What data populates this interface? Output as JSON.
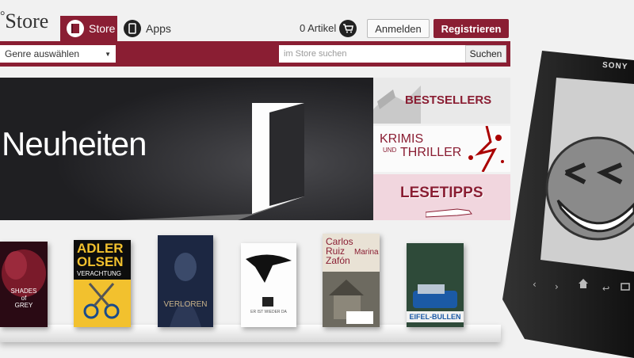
{
  "header": {
    "logo_text": "Store",
    "tabs": [
      {
        "label": "Store",
        "icon": "book-icon",
        "active": true
      },
      {
        "label": "Apps",
        "icon": "tablet-icon",
        "active": false
      }
    ],
    "cart_label": "0 Artikel",
    "login_label": "Anmelden",
    "register_label": "Registrieren"
  },
  "nav": {
    "genre_select": "Genre auswählen",
    "search_placeholder": "im Store suchen",
    "search_button": "Suchen"
  },
  "hero": {
    "title": "Neuheiten"
  },
  "banners": [
    {
      "label": "BESTSELLERS"
    },
    {
      "label_1": "KRIMIS",
      "label_2": "UND",
      "label_3": "THRILLER"
    },
    {
      "label": "LESETIPPS"
    }
  ],
  "books": [
    {
      "line1": "SHADES",
      "line2": "of",
      "line3": "GREY"
    },
    {
      "line1": "ADLER",
      "line2": "OLSEN",
      "line3": "VERACHTUNG"
    },
    {
      "line1": "VERLOREN"
    },
    {
      "line1": "ER IST WIEDER DA"
    },
    {
      "line1": "Carlos",
      "line2": "Ruiz",
      "line3": "Zafón",
      "line4": "Marina"
    },
    {
      "line1": "EIFEL-BULLEN"
    }
  ],
  "reader": {
    "brand": "SONY"
  },
  "colors": {
    "brand": "#8a1e33",
    "hero_bg": "#1f1f22",
    "page_bg": "#f1f1f1"
  }
}
